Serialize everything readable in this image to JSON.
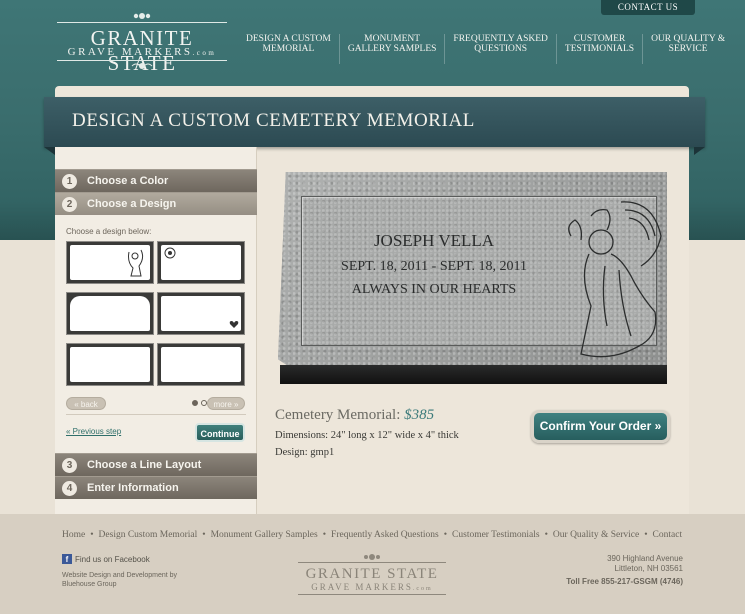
{
  "header": {
    "contact_label": "CONTACT US",
    "logo": {
      "line1": "GRANITE STATE",
      "line2": "GRAVE MARKERS",
      "suffix": ".com"
    },
    "nav": [
      {
        "line1": "DESIGN A CUSTOM",
        "line2": "MEMORIAL"
      },
      {
        "line1": "MONUMENT",
        "line2": "GALLERY SAMPLES"
      },
      {
        "line1": "FREQUENTLY ASKED",
        "line2": "QUESTIONS"
      },
      {
        "line1": "CUSTOMER",
        "line2": "TESTIMONIALS"
      },
      {
        "line1": "OUR QUALITY &",
        "line2": "SERVICE"
      }
    ]
  },
  "page": {
    "title": "DESIGN A CUSTOM CEMETERY MEMORIAL"
  },
  "steps": [
    {
      "num": "1",
      "label": "Choose a Color"
    },
    {
      "num": "2",
      "label": "Choose a Design"
    },
    {
      "num": "3",
      "label": "Choose a Line Layout"
    },
    {
      "num": "4",
      "label": "Enter Information"
    }
  ],
  "design_picker": {
    "prompt": "Choose a design below:",
    "back_label": "« back",
    "more_label": "more »",
    "pages": 5,
    "current_page": 1,
    "prev_label": "« Previous step",
    "continue_label": "Continue"
  },
  "preview": {
    "line1": "JOSEPH VELLA",
    "line2": "SEPT. 18, 2011 - SEPT. 18, 2011",
    "line3": "ALWAYS IN OUR HEARTS"
  },
  "product": {
    "name": "Cemetery Memorial:",
    "price": "$385",
    "dimensions_label": "Dimensions:",
    "dimensions_value": "24\" long x 12\" wide x 4\" thick",
    "design_label": "Design:",
    "design_value": "gmp1",
    "confirm_label": "Confirm Your Order »"
  },
  "footer": {
    "nav": [
      "Home",
      "Design Custom Memorial",
      "Monument Gallery Samples",
      "Frequently Asked Questions",
      "Customer Testimonials",
      "Our Quality & Service",
      "Contact"
    ],
    "facebook_label": "Find us on Facebook",
    "credit_line1": "Website Design and Development by",
    "credit_line2": "Bluehouse Group",
    "address_line1": "390 Highland Avenue",
    "address_line2": "Littleton, NH 03561",
    "toll_free": "Toll Free 855-217-GSGM (4746)"
  },
  "colors": {
    "teal": "#3f7676",
    "accent_price": "#3b7a7a",
    "ribbon": "#2c4a52"
  }
}
